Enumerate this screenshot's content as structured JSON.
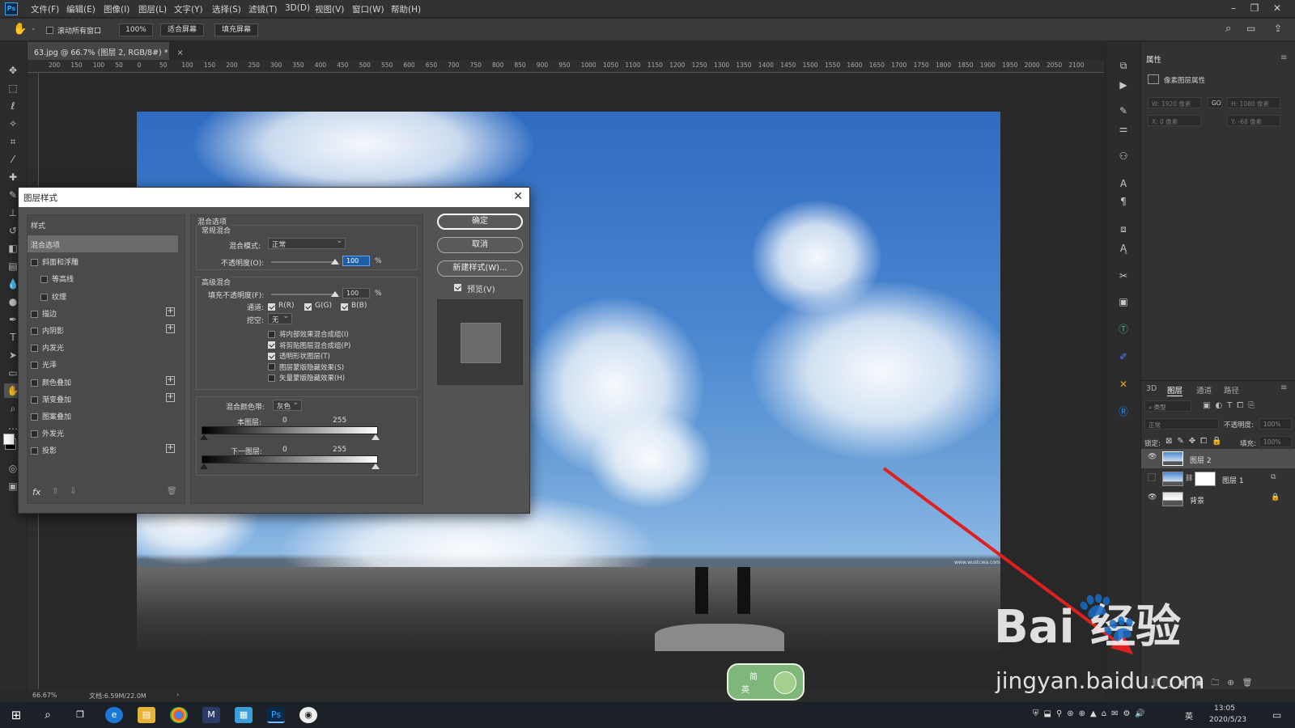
{
  "app": {
    "logo": "Ps",
    "menu": [
      "文件(F)",
      "编辑(E)",
      "图像(I)",
      "图层(L)",
      "文字(Y)",
      "选择(S)",
      "滤镜(T)",
      "3D(D)",
      "视图(V)",
      "窗口(W)",
      "帮助(H)"
    ]
  },
  "options_bar": {
    "scroll_all": "滚动所有窗口",
    "zoom": "100%",
    "fit_screen": "适合屏幕",
    "fill_screen": "填充屏幕"
  },
  "document": {
    "tab_title": "63.jpg @ 66.7% (图层 2, RGB/8#) *",
    "ruler_top": [
      "200",
      "150",
      "100",
      "50",
      "0",
      "50",
      "100",
      "150",
      "200",
      "250",
      "300",
      "350",
      "400",
      "450",
      "500",
      "550",
      "600",
      "650",
      "700",
      "750",
      "800",
      "850",
      "900",
      "950",
      "1000",
      "1050",
      "1100",
      "1150",
      "1200",
      "1250",
      "1300",
      "1350",
      "1400",
      "1450",
      "1500",
      "1550",
      "1600",
      "1650",
      "1700",
      "1750",
      "1800",
      "1850",
      "1900",
      "1950",
      "2000",
      "2050",
      "2100"
    ],
    "small_watermark": "www.wustcwa.com",
    "status_zoom": "66.67%",
    "status_doc": "文档:6.59M/22.0M"
  },
  "properties": {
    "tab": "属性",
    "subtitle": "像素图层属性",
    "w": "W: 1920 像素",
    "go": "GO",
    "h": "H: 1080 像素",
    "x": "X: 0 像素",
    "y": "Y: -68 像素"
  },
  "layers_panel": {
    "tabs": [
      "3D",
      "图层",
      "通道",
      "路径"
    ],
    "filter": "类型",
    "blend_mode": "正常",
    "opacity_label": "不透明度:",
    "opacity_value": "100%",
    "lock_label": "锁定:",
    "fill_label": "填充:",
    "fill_value": "100%",
    "layers": [
      {
        "name": "图层 2",
        "visible": true,
        "selected": true
      },
      {
        "name": "图层 1",
        "visible": false,
        "selected": false
      },
      {
        "name": "背景",
        "visible": true,
        "selected": false
      }
    ]
  },
  "dialog": {
    "title": "图层样式",
    "styles_header": "样式",
    "styles": [
      {
        "label": "混合选项",
        "checkbox": false,
        "plus": false,
        "indent": false,
        "selected": true
      },
      {
        "label": "斜面和浮雕",
        "checkbox": true,
        "plus": false,
        "indent": false
      },
      {
        "label": "等高线",
        "checkbox": true,
        "plus": false,
        "indent": true
      },
      {
        "label": "纹理",
        "checkbox": true,
        "plus": false,
        "indent": true
      },
      {
        "label": "描边",
        "checkbox": true,
        "plus": true,
        "indent": false
      },
      {
        "label": "内阴影",
        "checkbox": true,
        "plus": true,
        "indent": false
      },
      {
        "label": "内发光",
        "checkbox": true,
        "plus": false,
        "indent": false
      },
      {
        "label": "光泽",
        "checkbox": true,
        "plus": false,
        "indent": false
      },
      {
        "label": "颜色叠加",
        "checkbox": true,
        "plus": true,
        "indent": false
      },
      {
        "label": "渐变叠加",
        "checkbox": true,
        "plus": true,
        "indent": false
      },
      {
        "label": "图案叠加",
        "checkbox": true,
        "plus": false,
        "indent": false
      },
      {
        "label": "外发光",
        "checkbox": true,
        "plus": false,
        "indent": false
      },
      {
        "label": "投影",
        "checkbox": true,
        "plus": true,
        "indent": false
      }
    ],
    "fx": "fx",
    "blend_options_title": "混合选项",
    "general_blend": "常规混合",
    "blend_mode_label": "混合模式:",
    "blend_mode_value": "正常",
    "opacity_label": "不透明度(O):",
    "opacity_value": "100",
    "percent": "%",
    "advanced_blend": "高级混合",
    "fill_opacity_label": "填充不透明度(F):",
    "fill_opacity_value": "100",
    "channels_label": "通道:",
    "channel_r": "R(R)",
    "channel_g": "G(G)",
    "channel_b": "B(B)",
    "knockout_label": "挖空:",
    "knockout_value": "无",
    "adv_options": [
      {
        "label": "将内部效果混合成组(I)",
        "checked": false
      },
      {
        "label": "将剪贴图层混合成组(P)",
        "checked": true
      },
      {
        "label": "透明形状图层(T)",
        "checked": true
      },
      {
        "label": "图层蒙版隐藏效果(S)",
        "checked": false
      },
      {
        "label": "矢量蒙版隐藏效果(H)",
        "checked": false
      }
    ],
    "blend_if_label": "混合颜色带:",
    "blend_if_value": "灰色",
    "this_layer": "本图层:",
    "this_low": "0",
    "this_high": "255",
    "underlying": "下一图层:",
    "under_low": "0",
    "under_high": "255",
    "ok": "确定",
    "cancel": "取消",
    "new_style": "新建样式(W)...",
    "preview": "预览(V)"
  },
  "overlay": {
    "baidu_text": "Bai  经验",
    "baidu_url": "jingyan.baidu.com",
    "ime_top": "简",
    "ime_bottom": "英"
  },
  "taskbar": {
    "time": "13:05",
    "date": "2020/5/23",
    "ime_indicator": "英"
  },
  "colors": {
    "accent": "#31a8ff",
    "arrow": "#e02020",
    "dialog_bg": "#535353"
  }
}
